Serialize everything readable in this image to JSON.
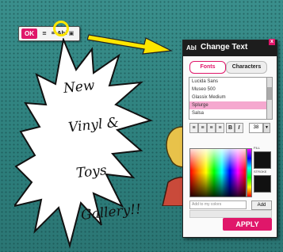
{
  "toolbar": {
    "ok_label": "OK",
    "icons": [
      "layers-icon",
      "crop-icon",
      "text-icon",
      "color-icon"
    ],
    "text_icon_label": "Abl"
  },
  "burst": {
    "lines": [
      "New",
      "Vinyl &",
      "Toys",
      "Gallery!!"
    ]
  },
  "panel": {
    "logo": "Abl",
    "title": "Change Text",
    "close": "x",
    "tabs": [
      "Fonts",
      "Characters"
    ],
    "active_tab": "Fonts",
    "fonts": [
      "Lucida Sans",
      "Museo 500",
      "Glassix Medium",
      "Splurge",
      "Salsa"
    ],
    "selected_font": "Splurge",
    "format_buttons": [
      "align-left",
      "align-center",
      "align-right",
      "align-justify",
      "B",
      "I"
    ],
    "font_size": "38",
    "swatch_labels": [
      "FILL",
      "STROKE"
    ],
    "add_placeholder": "Add to my colors",
    "add_label": "Add",
    "apply_label": "APPLY"
  },
  "colors": {
    "accent": "#e0176a",
    "highlight": "#ffe600",
    "background": "#2c7d7b"
  }
}
